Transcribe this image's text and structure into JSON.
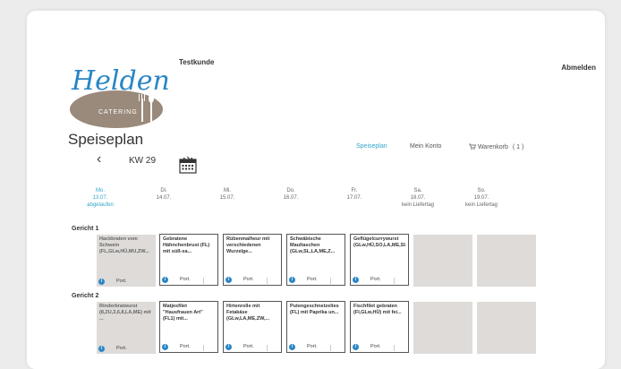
{
  "header": {
    "logo_text": "Helden",
    "logo_sub": "CATERING",
    "customer": "Testkunde",
    "logout": "Abmelden"
  },
  "page": {
    "title": "Speiseplan",
    "week_label": "KW 29",
    "prev_arrow": "‹",
    "next_arrow": "›"
  },
  "nav": {
    "menu": "Speiseplan",
    "account": "Mein Konto",
    "cart_icon": "cart-icon",
    "cart": "Warenkorb",
    "cart_count": "( 1 )"
  },
  "days": [
    {
      "name": "Mo.",
      "date": "13.07.",
      "note": "abgelaufen"
    },
    {
      "name": "Di.",
      "date": "14.07.",
      "note": ""
    },
    {
      "name": "Mi.",
      "date": "15.07.",
      "note": ""
    },
    {
      "name": "Do.",
      "date": "16.07.",
      "note": ""
    },
    {
      "name": "Fr.",
      "date": "17.07.",
      "note": ""
    },
    {
      "name": "Sa.",
      "date": "18.07.",
      "note": "kein Liefertag"
    },
    {
      "name": "So.",
      "date": "19.07.",
      "note": "kein Liefertag"
    }
  ],
  "sections": [
    {
      "title": "Gericht 1",
      "meals": [
        {
          "text": "Hackbraten vom Schwein (FL,GLw,HÜ,MU,ZW...",
          "port": "Port."
        },
        {
          "text": "Gebratene Hähnchenbrust (FL) mit süß-sa...",
          "port": "Port."
        },
        {
          "text": "Rübenmalheur mit verschiedenen Wurzelge...",
          "port": "Port."
        },
        {
          "text": "Schwäbische Maultaschen (GLw,SL,LA,ME,Z...",
          "port": "Port."
        },
        {
          "text": "Geflügelcurrywurst (GLw,HÜ,SO,LA,ME,SL...",
          "port": "Port."
        }
      ]
    },
    {
      "title": "Gericht 2",
      "meals": [
        {
          "text": "Rinderbratwurst (8,ZU,3,6,8,LA,ME) mit ...",
          "port": "Port."
        },
        {
          "text": "Matjesfilet \"Hausfrauen Art\" (FL1) mit...",
          "port": "Port."
        },
        {
          "text": "Hirtenrolle mit Fetakäse (GLw,LA,ME,ZW,...",
          "port": "Port."
        },
        {
          "text": "Putengeschnetzeltes (FL) mit Paprika un...",
          "port": "Port."
        },
        {
          "text": "Fischfilet gebraten (FI,GLw,HÜ) mit fei...",
          "port": "Port."
        }
      ]
    }
  ],
  "colors": {
    "accent": "#2fa6c8",
    "logo_blue": "#2a86c5",
    "logo_brown": "#9a8a7b"
  }
}
